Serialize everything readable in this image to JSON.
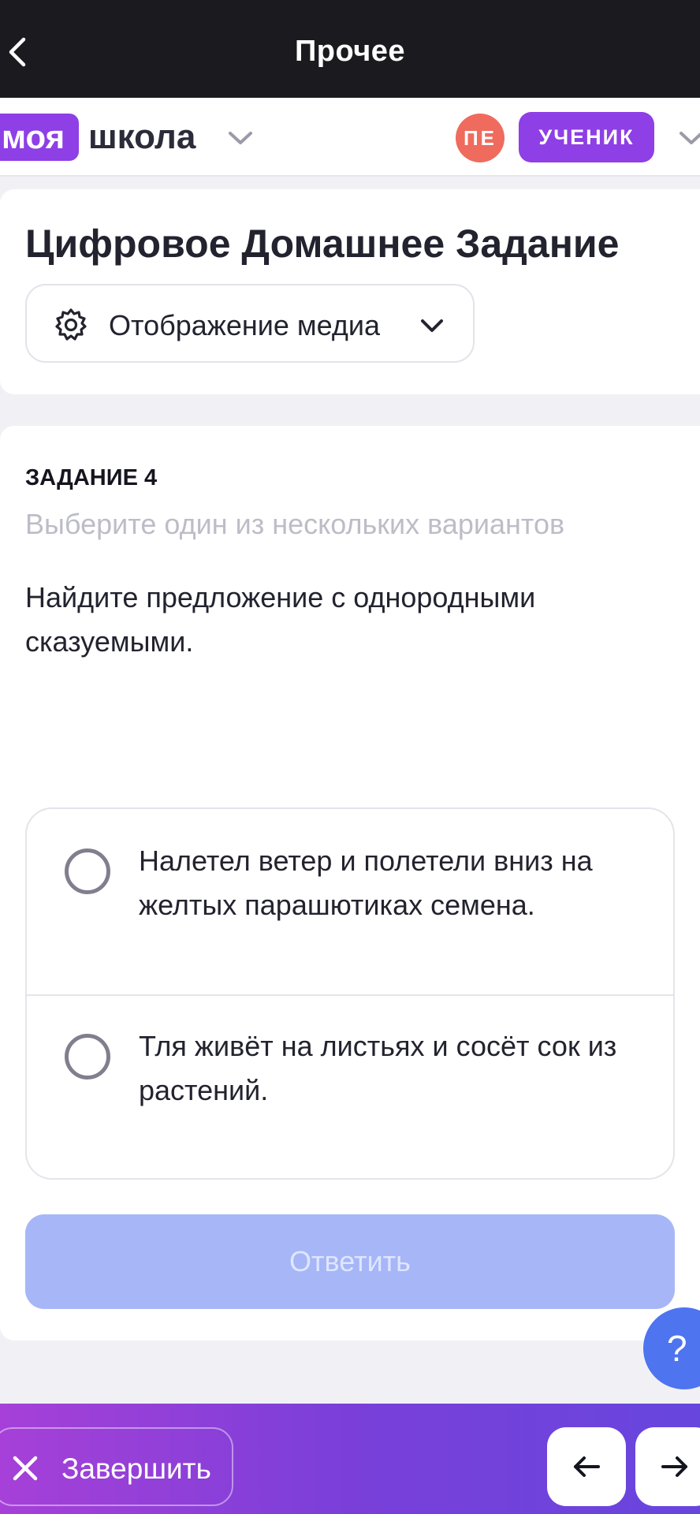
{
  "top_bar": {
    "title": "Прочее",
    "back_icon": "chevron-left-icon"
  },
  "app_bar": {
    "logo_part1": "моя",
    "logo_part2": "школа",
    "avatar_initials": "ПЕ",
    "role_label": "УЧЕНИК",
    "colors": {
      "brand": "#8e3fe6",
      "avatar": "#ef6b5d"
    }
  },
  "header_card": {
    "title": "Цифровое Домашнее Задание",
    "media_button_label": "Отображение медиа",
    "media_button_icon": "gear-icon"
  },
  "task": {
    "label": "ЗАДАНИЕ 4",
    "hint": "Выберите один из нескольких вариантов",
    "question": "Найдите предложение с однородными сказуемыми.",
    "options": [
      {
        "text": "Налетел ветер и полетели вниз  на желтых парашютиках семена.",
        "selected": false
      },
      {
        "text": "Тля живёт на листьях и сосёт сок из растений.",
        "selected": false
      }
    ],
    "answer_button_label": "Ответить"
  },
  "help_button_label": "?",
  "bottom_bar": {
    "finish_label": "Завершить",
    "prev_icon": "arrow-left-icon",
    "next_icon": "arrow-right-icon"
  }
}
